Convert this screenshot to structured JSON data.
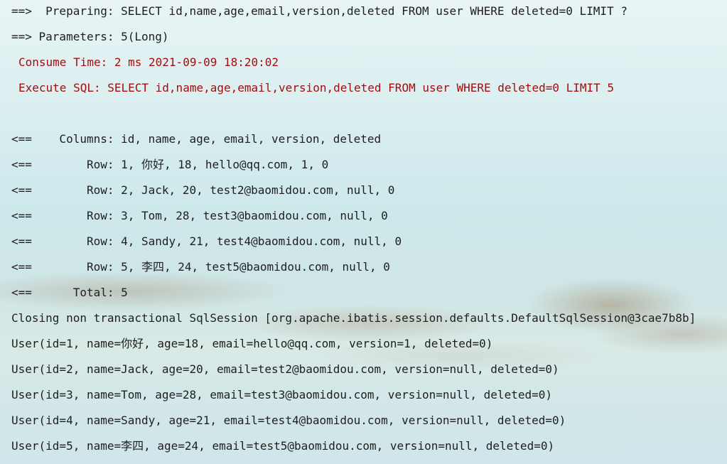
{
  "console": {
    "preparing": "==>  Preparing: SELECT id,name,age,email,version,deleted FROM user WHERE deleted=0 LIMIT ?",
    "parameters": "==> Parameters: 5(Long)",
    "consume_time": "Consume Time: 2 ms 2021-09-09 18:20:02",
    "execute_sql": "Execute SQL: SELECT id,name,age,email,version,deleted FROM user WHERE deleted=0 LIMIT 5",
    "columns": "<==    Columns: id, name, age, email, version, deleted",
    "rows": [
      "<==        Row: 1, 你好, 18, hello@qq.com, 1, 0",
      "<==        Row: 2, Jack, 20, test2@baomidou.com, null, 0",
      "<==        Row: 3, Tom, 28, test3@baomidou.com, null, 0",
      "<==        Row: 4, Sandy, 21, test4@baomidou.com, null, 0",
      "<==        Row: 5, 李四, 24, test5@baomidou.com, null, 0"
    ],
    "total": "<==      Total: 5",
    "closing": "Closing non transactional SqlSession [org.apache.ibatis.session.defaults.DefaultSqlSession@3cae7b8b]",
    "users": [
      "User(id=1, name=你好, age=18, email=hello@qq.com, version=1, deleted=0)",
      "User(id=2, name=Jack, age=20, email=test2@baomidou.com, version=null, deleted=0)",
      "User(id=3, name=Tom, age=28, email=test3@baomidou.com, version=null, deleted=0)",
      "User(id=4, name=Sandy, age=21, email=test4@baomidou.com, version=null, deleted=0)",
      "User(id=5, name=李四, age=24, email=test5@baomidou.com, version=null, deleted=0)"
    ]
  },
  "colors": {
    "text": "#1e1e1e",
    "error_text": "#a30d0d"
  }
}
